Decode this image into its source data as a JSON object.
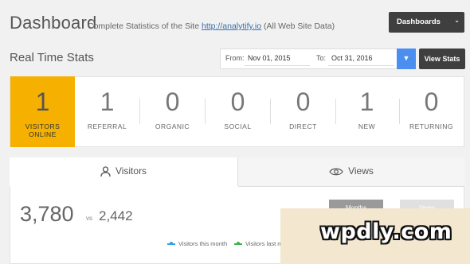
{
  "header": {
    "title": "Dashboard",
    "subtitle_prefix": "Complete Statistics of the Site",
    "site_link": "http://analytify.io",
    "subtitle_suffix": "(All Web Site Data)",
    "dashboards_button": "Dashboards"
  },
  "realtime": {
    "title": "Real Time Stats",
    "from_label": "From:",
    "from_value": "Nov 01, 2015",
    "to_label": "To:",
    "to_value": "Oct 31, 2016",
    "view_button": "View Stats"
  },
  "stats": [
    {
      "value": "1",
      "label": "VISITORS ONLINE"
    },
    {
      "value": "1",
      "label": "REFERRAL"
    },
    {
      "value": "0",
      "label": "ORGANIC"
    },
    {
      "value": "0",
      "label": "SOCIAL"
    },
    {
      "value": "0",
      "label": "DIRECT"
    },
    {
      "value": "1",
      "label": "NEW"
    },
    {
      "value": "0",
      "label": "RETURNING"
    }
  ],
  "tabs": {
    "visitors": "Visitors",
    "views": "Views"
  },
  "comparison": {
    "current": "3,780",
    "vs": "vs",
    "previous": "2,442",
    "months_button": "Months",
    "years_button": "Years"
  },
  "legend": [
    {
      "label": "Visitors this month",
      "color": "#2fa4e7"
    },
    {
      "label": "Visitors last m",
      "color": "#3cb44b"
    }
  ],
  "watermark": "wpdly.com",
  "colors": {
    "accent": "#f5b000",
    "dark_button": "#3f3f3f",
    "blue_button": "#4a8ff0"
  }
}
